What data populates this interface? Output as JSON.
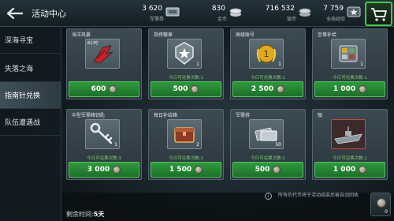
{
  "header": {
    "title": "活动中心",
    "resources": [
      {
        "value": "3 620",
        "label": "军需券",
        "icon": "ticket-icon"
      },
      {
        "value": "830",
        "label": "金币",
        "icon": "gold-icon"
      },
      {
        "value": "716 532",
        "label": "银币",
        "icon": "silver-icon"
      },
      {
        "value": "7 759",
        "label": "全局经验",
        "icon": "star-icon"
      }
    ]
  },
  "sidebar": {
    "items": [
      {
        "label": "深海寻宝"
      },
      {
        "label": "失落之海"
      },
      {
        "label": "指南针兑换"
      },
      {
        "label": "队伍遭遇战"
      }
    ],
    "active_index": 2
  },
  "items": [
    {
      "name": "海洋风暴",
      "qty": "",
      "badge": "6小时",
      "limit": "",
      "price": "600"
    },
    {
      "name": "指挥徽章",
      "qty": "1",
      "badge": "",
      "limit": "今日可兑换次数:1",
      "price": "500"
    },
    {
      "name": "高级账号",
      "qty": "1",
      "badge": "",
      "limit": "今日可兑换次数:1",
      "price": "2 500"
    },
    {
      "name": "至尊补给",
      "qty": "1",
      "badge": "",
      "limit": "今日可兑换次数:1",
      "price": "1 000"
    },
    {
      "name": "中型军需箱钥匙",
      "qty": "1",
      "badge": "",
      "limit": "今日可兑换次数:3",
      "price": "3 000"
    },
    {
      "name": "每日补给箱",
      "qty": "2",
      "badge": "",
      "limit": "今日可兑换次数:2",
      "price": "1 500"
    },
    {
      "name": "军需券",
      "qty": "50",
      "badge": "",
      "limit": "今日可兑换次数:2",
      "price": "500"
    },
    {
      "name": "舰",
      "qty": "",
      "badge": "",
      "limit": "今日可兑换次数:1",
      "price": "1 000"
    }
  ],
  "footer": {
    "remaining_label": "剩余时间:",
    "remaining_value": "5天",
    "notice": "所有的代币将于活动结束后被自动回收",
    "token_count": "0"
  },
  "colors": {
    "accent_green": "#2e9a3c",
    "limit_text": "#7ed46a"
  }
}
